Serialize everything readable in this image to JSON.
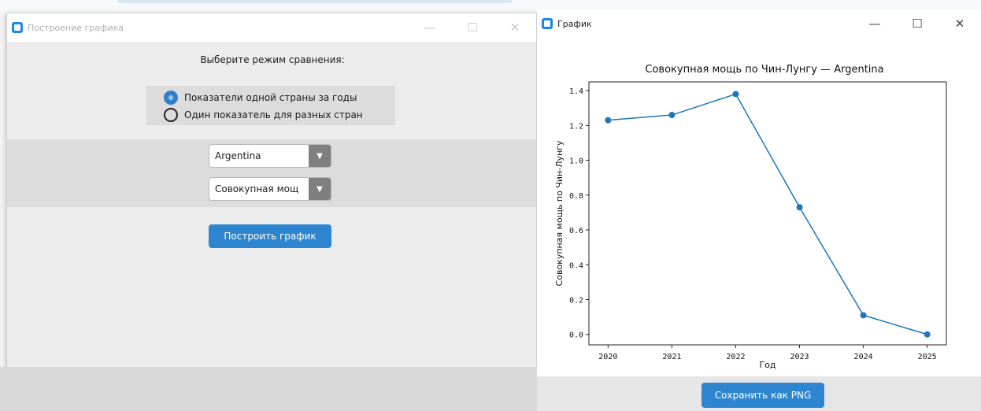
{
  "left_window": {
    "title": "Построение графика",
    "prompt": "Выберите режим сравнения:",
    "radio_options": [
      {
        "label": "Показатели одной страны за годы",
        "checked": true
      },
      {
        "label": "Один показатель для разных стран",
        "checked": false
      }
    ],
    "country_combo_value": "Argentina",
    "indicator_combo_value": "Совокупная мощ",
    "build_button": "Построить график",
    "controls": {
      "minimize": "—",
      "maximize": "☐",
      "close": "✕"
    }
  },
  "right_window": {
    "title": "График",
    "save_button": "Сохранить как PNG",
    "controls": {
      "minimize": "—",
      "maximize": "☐",
      "close": "✕"
    }
  },
  "colors": {
    "accent": "#2e86d0",
    "line": "#1f77b4"
  },
  "chart_data": {
    "type": "line",
    "title": "Совокупная мощь по Чин-Лунгу — Argentina",
    "xlabel": "Год",
    "ylabel": "Совокупная мощь по Чин-Лунгу",
    "x": [
      2020,
      2021,
      2022,
      2023,
      2024,
      2025
    ],
    "series": [
      {
        "values": [
          1.23,
          1.26,
          1.38,
          0.73,
          0.11,
          0.0
        ]
      }
    ],
    "yticks": [
      0.0,
      0.2,
      0.4,
      0.6,
      0.8,
      1.0,
      1.2,
      1.4
    ],
    "ytick_labels": [
      "0.0",
      "0.2",
      "0.4",
      "0.6",
      "0.8",
      "1.0",
      "1.2",
      "1.4"
    ],
    "xtick_labels": [
      "2020",
      "2021",
      "2022",
      "2023",
      "2024",
      "2025"
    ],
    "ylim": [
      -0.06,
      1.45
    ],
    "xlim": [
      2019.7,
      2025.3
    ],
    "grid": false
  }
}
